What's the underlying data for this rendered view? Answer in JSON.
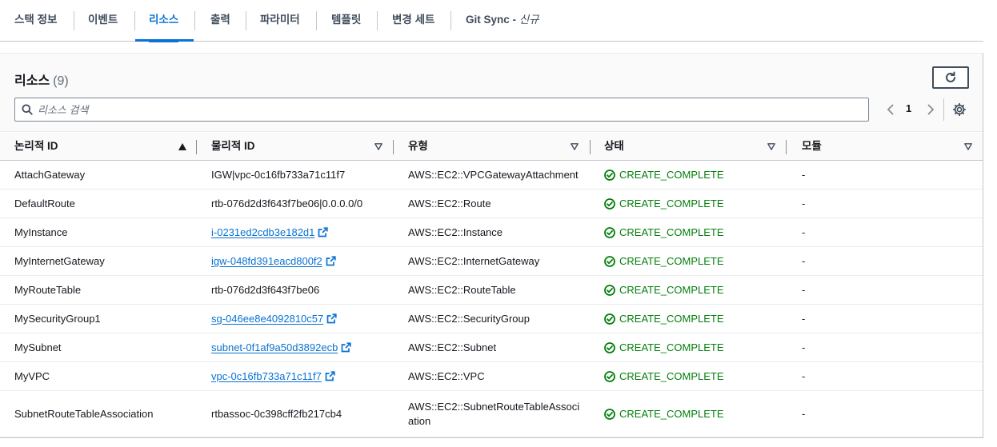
{
  "tabs": [
    {
      "label": "스택 정보"
    },
    {
      "label": "이벤트"
    },
    {
      "label": "리소스"
    },
    {
      "label": "출력"
    },
    {
      "label": "파라미터"
    },
    {
      "label": "템플릿"
    },
    {
      "label": "변경 세트"
    },
    {
      "label": "Git Sync - ",
      "suffix": "신규"
    }
  ],
  "active_tab": "리소스",
  "panel": {
    "title": "리소스",
    "count": "(9)",
    "search_placeholder": "리소스 검색",
    "page": "1"
  },
  "columns": [
    "논리적 ID",
    "물리적 ID",
    "유형",
    "상태",
    "모듈"
  ],
  "rows": [
    {
      "logical_id": "AttachGateway",
      "physical_id": "IGW|vpc-0c16fb733a71c11f7",
      "physical_link": false,
      "type": "AWS::EC2::VPCGatewayAttachment",
      "status": "CREATE_COMPLETE",
      "module": "-"
    },
    {
      "logical_id": "DefaultRoute",
      "physical_id": "rtb-076d2d3f643f7be06|0.0.0.0/0",
      "physical_link": false,
      "type": "AWS::EC2::Route",
      "status": "CREATE_COMPLETE",
      "module": "-"
    },
    {
      "logical_id": "MyInstance",
      "physical_id": "i-0231ed2cdb3e182d1",
      "physical_link": true,
      "type": "AWS::EC2::Instance",
      "status": "CREATE_COMPLETE",
      "module": "-"
    },
    {
      "logical_id": "MyInternetGateway",
      "physical_id": "igw-048fd391eacd800f2",
      "physical_link": true,
      "type": "AWS::EC2::InternetGateway",
      "status": "CREATE_COMPLETE",
      "module": "-"
    },
    {
      "logical_id": "MyRouteTable",
      "physical_id": "rtb-076d2d3f643f7be06",
      "physical_link": false,
      "type": "AWS::EC2::RouteTable",
      "status": "CREATE_COMPLETE",
      "module": "-"
    },
    {
      "logical_id": "MySecurityGroup1",
      "physical_id": "sg-046ee8e4092810c57",
      "physical_link": true,
      "type": "AWS::EC2::SecurityGroup",
      "status": "CREATE_COMPLETE",
      "module": "-"
    },
    {
      "logical_id": "MySubnet",
      "physical_id": "subnet-0f1af9a50d3892ecb",
      "physical_link": true,
      "type": "AWS::EC2::Subnet",
      "status": "CREATE_COMPLETE",
      "module": "-"
    },
    {
      "logical_id": "MyVPC",
      "physical_id": "vpc-0c16fb733a71c11f7",
      "physical_link": true,
      "type": "AWS::EC2::VPC",
      "status": "CREATE_COMPLETE",
      "module": "-"
    },
    {
      "logical_id": "SubnetRouteTableAssociation",
      "physical_id": "rtbassoc-0c398cff2fb217cb4",
      "physical_link": false,
      "type": "AWS::EC2::SubnetRouteTableAssociation",
      "status": "CREATE_COMPLETE",
      "module": "-"
    }
  ],
  "colors": {
    "accent": "#0972d3",
    "success": "#037f0c",
    "text": "#16191f"
  }
}
